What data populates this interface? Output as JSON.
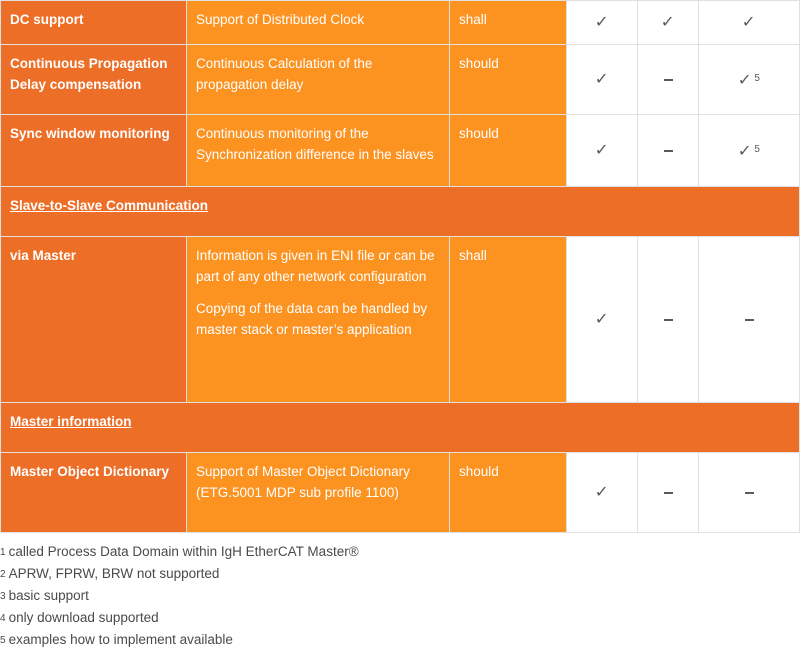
{
  "colors": {
    "name_column": "#ec6e27",
    "description_column": "#fc9220",
    "section_row": "#ec6e27",
    "mark": "#555b63",
    "border": "#e0e0e0"
  },
  "rows": [
    {
      "type": "feature",
      "name": "DC support",
      "description": [
        "Support of Distributed Clock"
      ],
      "requirement": "shall",
      "marks": [
        {
          "kind": "check",
          "icon": "check-icon",
          "footnote": ""
        },
        {
          "kind": "check",
          "icon": "check-icon",
          "footnote": ""
        },
        {
          "kind": "check",
          "icon": "check-icon",
          "footnote": ""
        }
      ]
    },
    {
      "type": "feature",
      "name": "Continuous Propagation Delay compensation",
      "description": [
        "Continuous Calculation of the propagation delay"
      ],
      "requirement": "should",
      "marks": [
        {
          "kind": "check",
          "icon": "check-icon",
          "footnote": ""
        },
        {
          "kind": "dash",
          "icon": "dash-icon",
          "footnote": ""
        },
        {
          "kind": "check",
          "icon": "check-icon",
          "footnote": "5"
        }
      ]
    },
    {
      "type": "feature",
      "name": "Sync window monitoring",
      "description": [
        "Continuous monitoring of the Synchronization difference in the slaves"
      ],
      "requirement": "should",
      "marks": [
        {
          "kind": "check",
          "icon": "check-icon",
          "footnote": ""
        },
        {
          "kind": "dash",
          "icon": "dash-icon",
          "footnote": ""
        },
        {
          "kind": "check",
          "icon": "check-icon",
          "footnote": "5"
        }
      ]
    },
    {
      "type": "section",
      "title": "Slave-to-Slave Communication"
    },
    {
      "type": "feature",
      "name": "via Master",
      "description": [
        "Information is given in ENI file or can be part of any other network configuration",
        "Copying of the data can be handled by master stack or master’s application"
      ],
      "requirement": "shall",
      "marks": [
        {
          "kind": "check",
          "icon": "check-icon",
          "footnote": ""
        },
        {
          "kind": "dash",
          "icon": "dash-icon",
          "footnote": ""
        },
        {
          "kind": "dash",
          "icon": "dash-icon",
          "footnote": ""
        }
      ]
    },
    {
      "type": "section",
      "title": "Master information"
    },
    {
      "type": "feature",
      "name": "Master Object Dictionary",
      "description": [
        "Support of Master Object Dictionary (ETG.5001 MDP sub profile 1100)"
      ],
      "requirement": "should",
      "marks": [
        {
          "kind": "check",
          "icon": "check-icon",
          "footnote": ""
        },
        {
          "kind": "dash",
          "icon": "dash-icon",
          "footnote": ""
        },
        {
          "kind": "dash",
          "icon": "dash-icon",
          "footnote": ""
        }
      ]
    }
  ],
  "footnotes": [
    {
      "num": "1",
      "text": "called Process Data Domain within IgH EtherCAT Master®"
    },
    {
      "num": "2",
      "text": "APRW, FPRW, BRW not supported"
    },
    {
      "num": "3",
      "text": "basic support"
    },
    {
      "num": "4",
      "text": "only download supported"
    },
    {
      "num": "5",
      "text": "examples how to implement available"
    }
  ],
  "symbols": {
    "check": "✓"
  }
}
